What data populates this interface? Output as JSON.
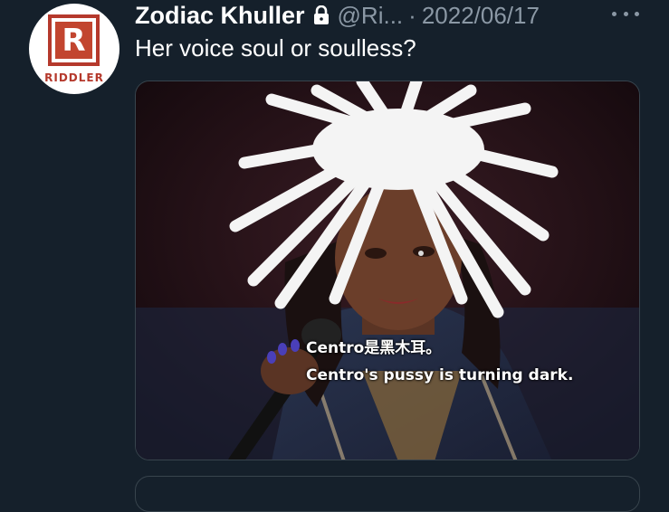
{
  "tweet": {
    "avatar_text": "RIDDLER",
    "avatar_letter": "R",
    "display_name": "Zodiac Khuller",
    "handle": "@Ri...",
    "separator": "·",
    "date": "2022/06/17",
    "text": "Her voice soul or soulless?",
    "media": {
      "caption_line1": "Centro是黑木耳。",
      "caption_line2": "Centro's pussy is turning dark."
    }
  },
  "icons": {
    "lock": "lock-icon",
    "more": "more-options-icon"
  }
}
